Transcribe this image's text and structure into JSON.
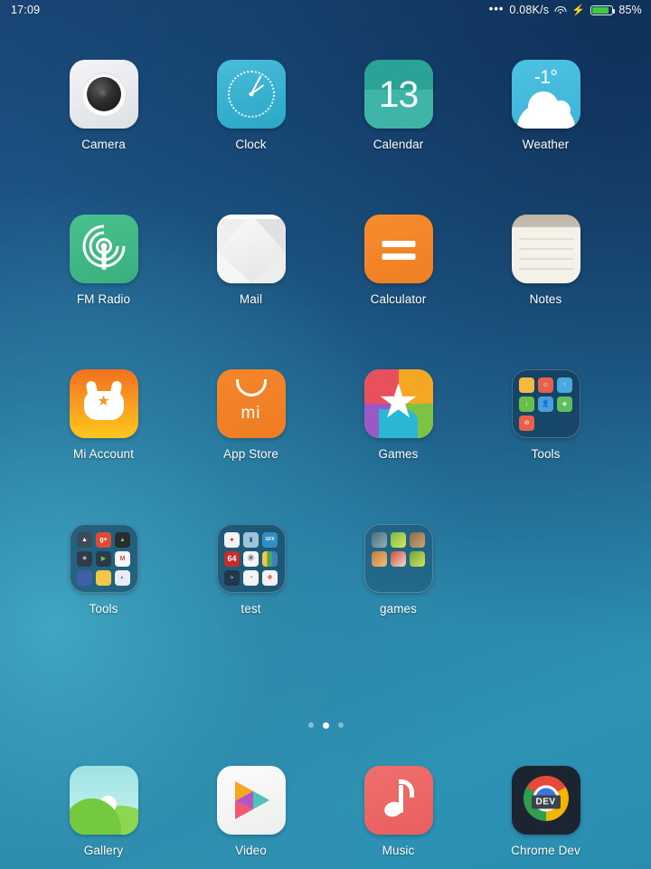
{
  "status_bar": {
    "time": "17:09",
    "dots": "•••",
    "network_speed": "0.08K/s",
    "wifi_icon": "wifi-icon",
    "charging_icon": "lightning-bolt-icon",
    "battery_percent": "85%",
    "battery_level": 85,
    "battery_color": "#3fcb3f"
  },
  "home_screen": {
    "page_indicator": {
      "total": 3,
      "active_index": 1
    },
    "rows": [
      [
        {
          "name": "Camera",
          "icon": "camera-icon",
          "type": "app"
        },
        {
          "name": "Clock",
          "icon": "clock-icon",
          "type": "app"
        },
        {
          "name": "Calendar",
          "icon": "calendar-icon",
          "type": "app",
          "badge": "13"
        },
        {
          "name": "Weather",
          "icon": "weather-icon",
          "type": "app",
          "badge": "-1°"
        }
      ],
      [
        {
          "name": "FM Radio",
          "icon": "fm-radio-icon",
          "type": "app"
        },
        {
          "name": "Mail",
          "icon": "mail-icon",
          "type": "app"
        },
        {
          "name": "Calculator",
          "icon": "calculator-icon",
          "type": "app"
        },
        {
          "name": "Notes",
          "icon": "notes-icon",
          "type": "app"
        }
      ],
      [
        {
          "name": "Mi Account",
          "icon": "mi-account-icon",
          "type": "app"
        },
        {
          "name": "App Store",
          "icon": "app-store-icon",
          "type": "app",
          "logo_text": "mi"
        },
        {
          "name": "Games",
          "icon": "games-icon",
          "type": "app"
        },
        {
          "name": "Tools",
          "icon": "folder-icon",
          "type": "folder"
        }
      ],
      [
        {
          "name": "Tools",
          "icon": "folder-icon",
          "type": "folder"
        },
        {
          "name": "test",
          "icon": "folder-icon",
          "type": "folder"
        },
        {
          "name": "games",
          "icon": "folder-icon",
          "type": "folder"
        },
        {
          "name": "",
          "icon": "",
          "type": "empty"
        }
      ]
    ],
    "dock": [
      {
        "name": "Gallery",
        "icon": "gallery-icon",
        "type": "app"
      },
      {
        "name": "Video",
        "icon": "video-icon",
        "type": "app"
      },
      {
        "name": "Music",
        "icon": "music-icon",
        "type": "app"
      },
      {
        "name": "Chrome Dev",
        "icon": "chrome-dev-icon",
        "type": "app",
        "badge": "DEV"
      }
    ]
  },
  "folders": {
    "tools_miui": {
      "label": "Tools",
      "item_colors": [
        "#f5b942",
        "#e8604c",
        "#4aa8e0",
        "#6abf4b",
        "#4a9fe0",
        "#5fbf5f",
        "#e8604c",
        "",
        ""
      ]
    },
    "tools_google": {
      "label": "Tools",
      "item_colors": [
        "#3c4a5a",
        "#dd4b39",
        "#2b2b2b",
        "#2f3b49",
        "#2b3a48",
        "#f5f5f5",
        "#3f5fa8",
        "#f2c744",
        "#2f5fa8"
      ]
    },
    "test": {
      "label": "test",
      "item_colors": [
        "#f2f2f2",
        "#9fc3dd",
        "#2f8fc4",
        "#c92a2a",
        "#f4f7fa",
        "#e8e2d0",
        "#20394a",
        "#f0f4f7",
        "#f2f2f2"
      ],
      "item_labels": [
        "",
        "",
        "GFX",
        "64",
        "",
        "",
        "",
        "",
        ""
      ]
    },
    "games": {
      "label": "games",
      "item_colors": [
        "#4a6e7a",
        "#79b84a",
        "#8a6a4a",
        "#c47a3a",
        "#d04a3a",
        "#6aa83a"
      ]
    }
  },
  "colors": {
    "accent_orange": "#f08024",
    "accent_green": "#3fb07e",
    "accent_teal": "#2fa99b",
    "accent_red": "#e95f5f",
    "label_text": "#ffffff",
    "wallpaper_top": "#1b4a7d",
    "wallpaper_bottom": "#2d93b4"
  }
}
